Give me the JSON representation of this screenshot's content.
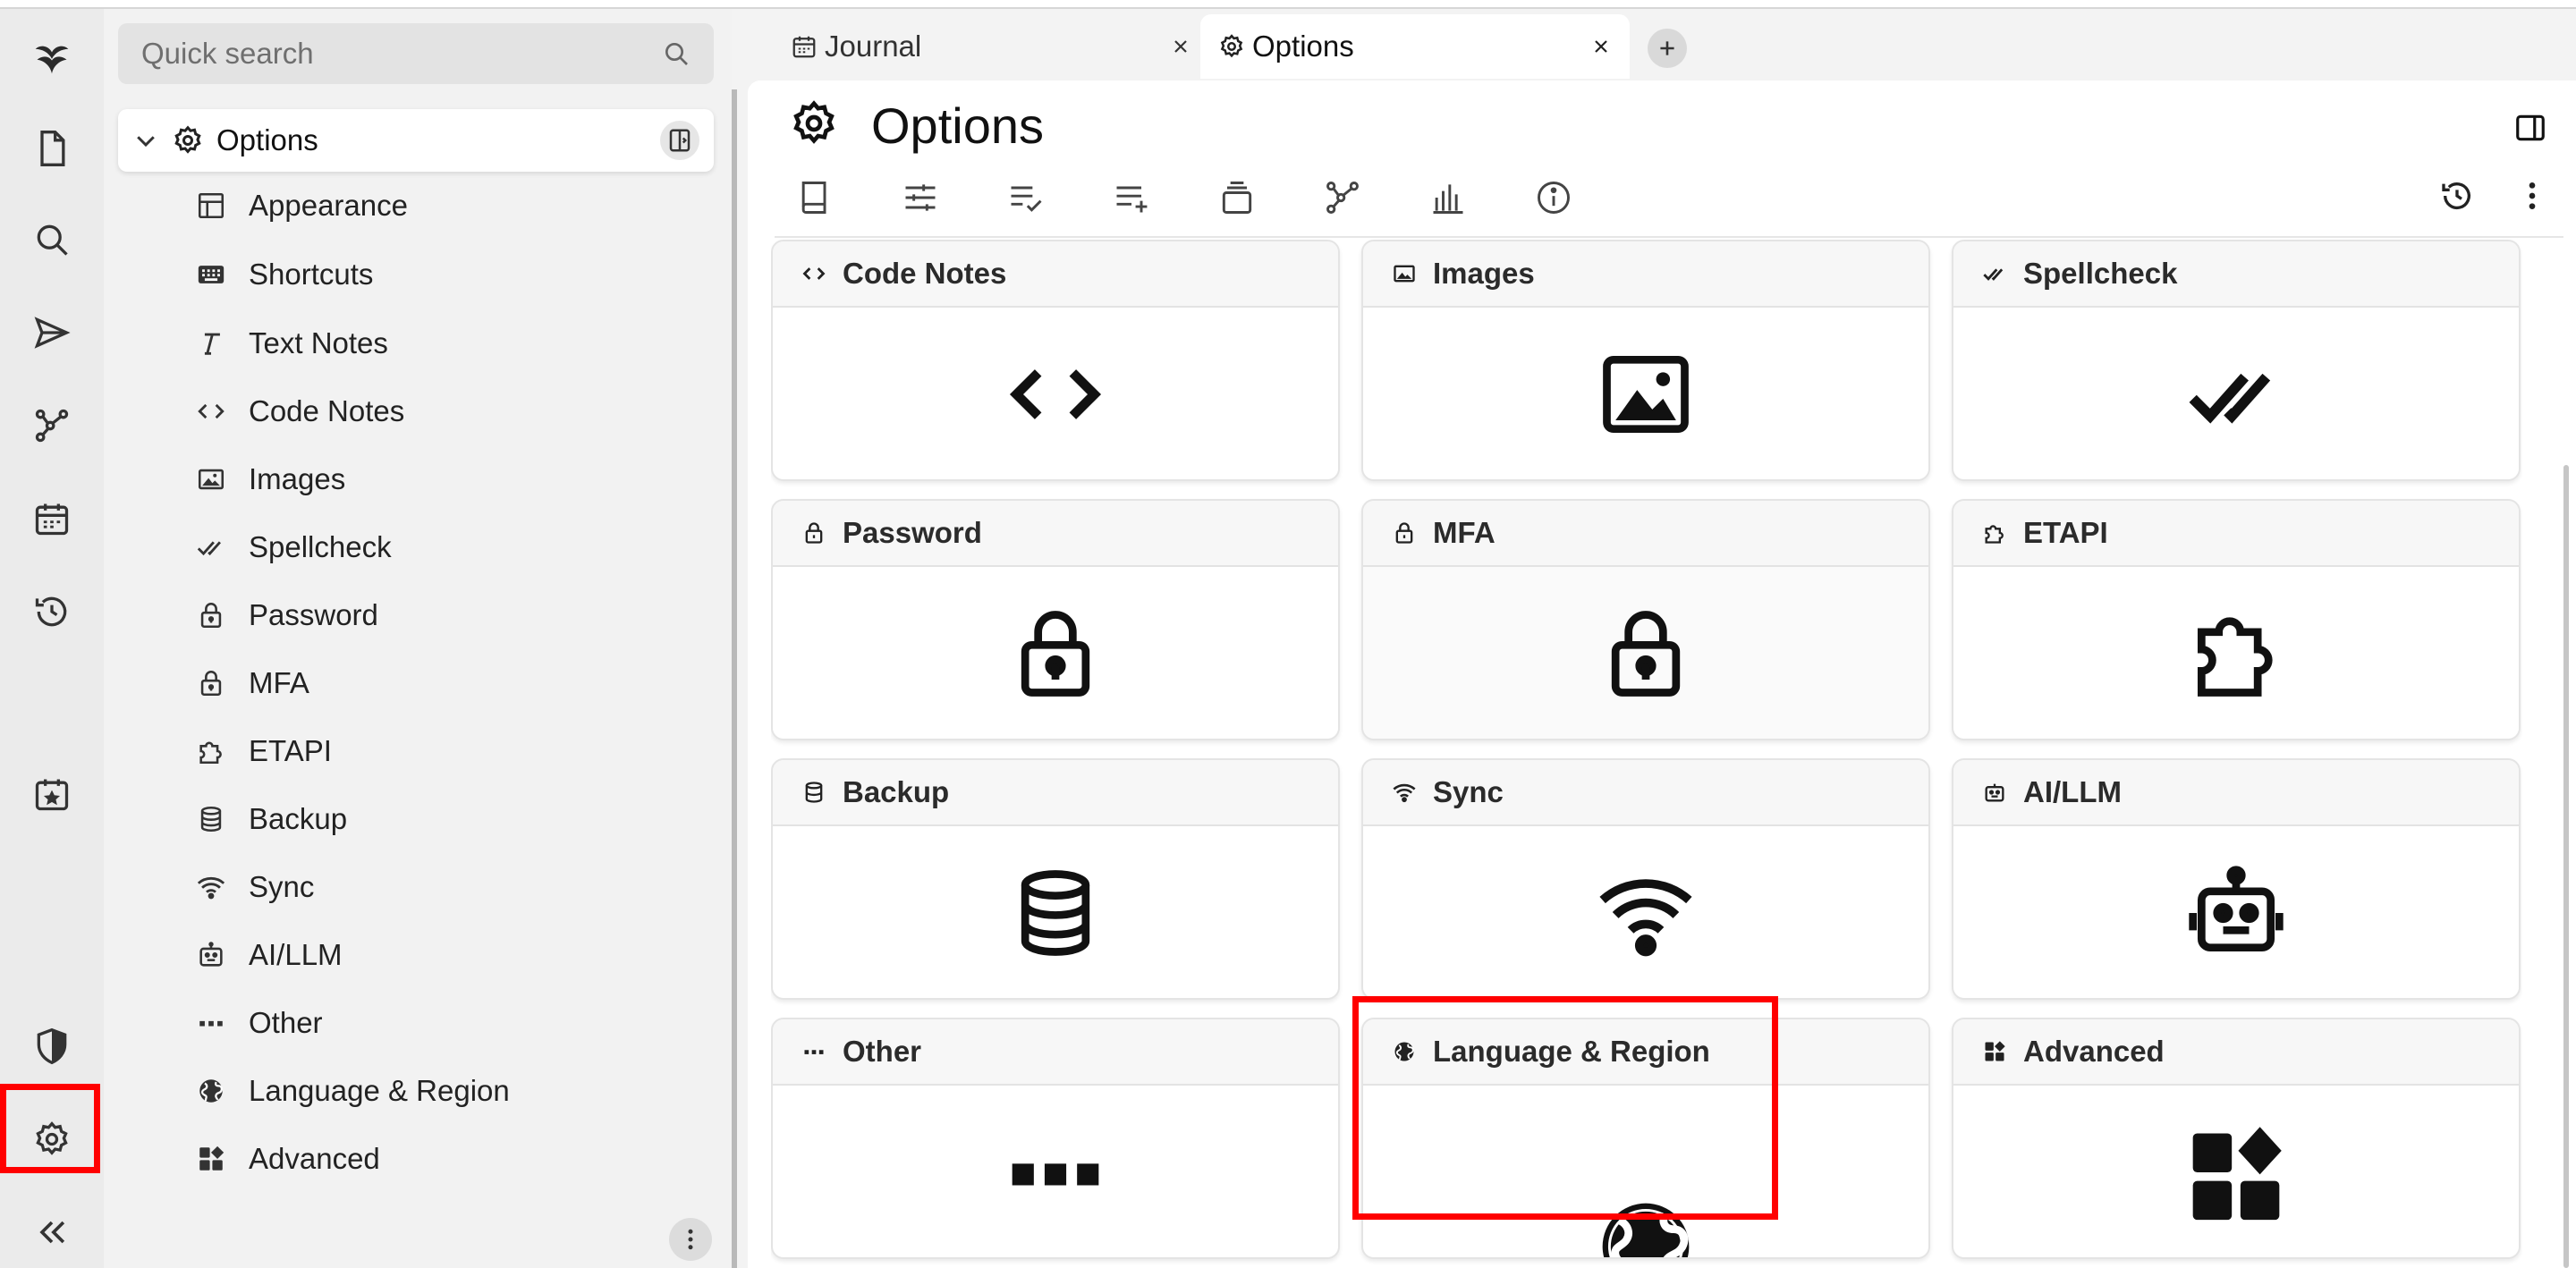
{
  "search": {
    "placeholder": "Quick search"
  },
  "tree": {
    "root_label": "Options",
    "items": [
      {
        "label": "Appearance",
        "icon": "layout-icon"
      },
      {
        "label": "Shortcuts",
        "icon": "keyboard-icon"
      },
      {
        "label": "Text Notes",
        "icon": "italic-t-icon"
      },
      {
        "label": "Code Notes",
        "icon": "code-icon"
      },
      {
        "label": "Images",
        "icon": "image-icon"
      },
      {
        "label": "Spellcheck",
        "icon": "double-check-icon"
      },
      {
        "label": "Password",
        "icon": "lock-icon"
      },
      {
        "label": "MFA",
        "icon": "lock-icon"
      },
      {
        "label": "ETAPI",
        "icon": "puzzle-icon"
      },
      {
        "label": "Backup",
        "icon": "database-icon"
      },
      {
        "label": "Sync",
        "icon": "wifi-icon"
      },
      {
        "label": "AI/LLM",
        "icon": "robot-icon"
      },
      {
        "label": "Other",
        "icon": "dots-icon"
      },
      {
        "label": "Language & Region",
        "icon": "globe-icon"
      },
      {
        "label": "Advanced",
        "icon": "widgets-icon"
      }
    ]
  },
  "tabs": [
    {
      "label": "Journal",
      "icon": "calendar-icon",
      "active": false
    },
    {
      "label": "Options",
      "icon": "gear-icon",
      "active": true
    }
  ],
  "page": {
    "title": "Options"
  },
  "cards": [
    {
      "label": "Code Notes",
      "icon": "code-icon"
    },
    {
      "label": "Images",
      "icon": "image-icon"
    },
    {
      "label": "Spellcheck",
      "icon": "double-check-icon"
    },
    {
      "label": "Password",
      "icon": "lock-icon"
    },
    {
      "label": "MFA",
      "icon": "lock-icon"
    },
    {
      "label": "ETAPI",
      "icon": "puzzle-icon"
    },
    {
      "label": "Backup",
      "icon": "database-icon"
    },
    {
      "label": "Sync",
      "icon": "wifi-icon"
    },
    {
      "label": "AI/LLM",
      "icon": "robot-icon"
    },
    {
      "label": "Other",
      "icon": "dots-icon"
    },
    {
      "label": "Language & Region",
      "icon": "globe-icon"
    },
    {
      "label": "Advanced",
      "icon": "widgets-icon"
    }
  ],
  "colors": {
    "highlight": "#ff0000",
    "background": "#f3f3f3",
    "card_header": "#f7f7f7"
  }
}
